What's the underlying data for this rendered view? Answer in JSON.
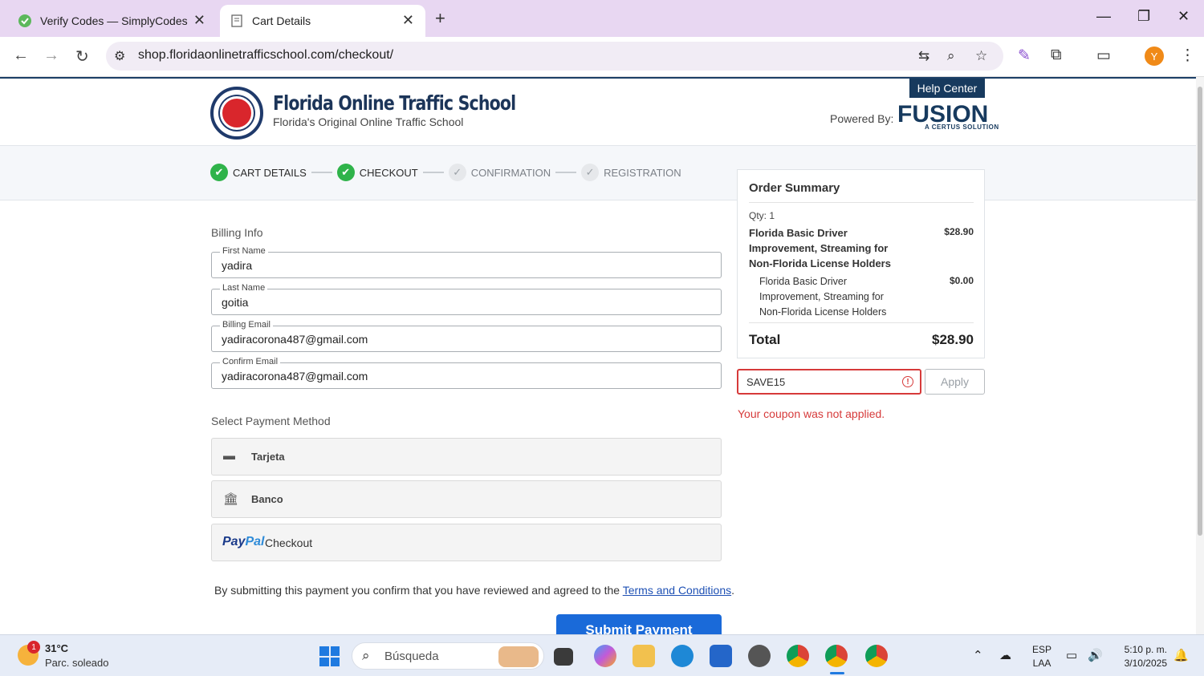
{
  "browser": {
    "tabs": [
      {
        "title": "Verify Codes — SimplyCodes",
        "active": false
      },
      {
        "title": "Cart Details",
        "active": true
      }
    ],
    "url": "shop.floridaonlinetrafficschool.com/checkout/",
    "profile_initial": "Y"
  },
  "header": {
    "brand_title": "Florida Online Traffic School",
    "brand_subtitle": "Florida's Original Online Traffic School",
    "help_center": "Help Center",
    "powered_by": "Powered By:",
    "fusion": "FUSION",
    "certus": "A CERTUS SOLUTION"
  },
  "steps": [
    {
      "label": "CART DETAILS",
      "state": "done"
    },
    {
      "label": "CHECKOUT",
      "state": "done"
    },
    {
      "label": "CONFIRMATION",
      "state": "todo"
    },
    {
      "label": "REGISTRATION",
      "state": "todo"
    }
  ],
  "billing": {
    "section_title": "Billing Info",
    "first_name_label": "First Name",
    "first_name": "yadira",
    "last_name_label": "Last Name",
    "last_name": "goitia",
    "email_label": "Billing Email",
    "email": "yadiracorona487@gmail.com",
    "confirm_email_label": "Confirm Email",
    "confirm_email": "yadiracorona487@gmail.com"
  },
  "payment": {
    "section_title": "Select Payment Method",
    "card_label": "Tarjeta",
    "bank_label": "Banco",
    "paypal_logo_a": "Pay",
    "paypal_logo_b": "Pal",
    "paypal_label": "Checkout"
  },
  "terms": {
    "text": "By submitting this payment you confirm that you have reviewed and agreed to the ",
    "link": "Terms and Conditions",
    "end": "."
  },
  "submit_label": "Submit Payment",
  "order_summary": {
    "title": "Order Summary",
    "qty": "Qty: 1",
    "item": "Florida Basic Driver Improvement, Streaming for Non-Florida License Holders",
    "item_price": "$28.90",
    "sub_item": "Florida Basic Driver Improvement, Streaming for Non-Florida License Holders",
    "sub_item_price": "$0.00",
    "total_label": "Total",
    "total": "$28.90"
  },
  "coupon": {
    "value": "SAVE15",
    "apply_label": "Apply",
    "error": "Your coupon was not applied."
  },
  "taskbar": {
    "temp": "31°C",
    "weather": "Parc. soleado",
    "weather_badge": "1",
    "search_placeholder": "Búsqueda",
    "lang_1": "ESP",
    "lang_2": "LAA",
    "time": "5:10 p. m.",
    "date": "3/10/2025"
  }
}
